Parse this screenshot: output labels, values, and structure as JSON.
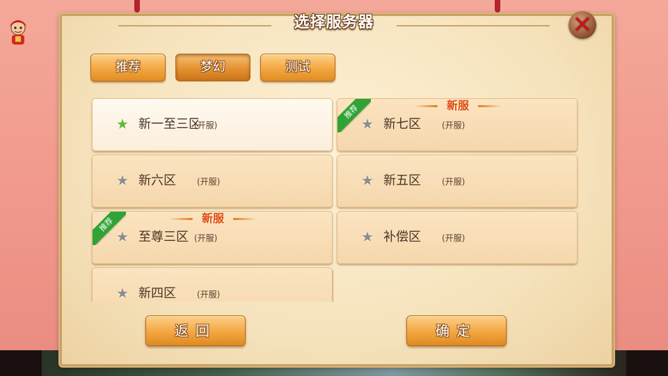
{
  "dialog": {
    "title": "选择服务器",
    "close_icon": "close-x-icon"
  },
  "tabs": [
    {
      "label": "推荐",
      "active": false
    },
    {
      "label": "梦幻",
      "active": true
    },
    {
      "label": "测试",
      "active": false
    }
  ],
  "servers": [
    {
      "name": "新一至三区",
      "status": "(开服)",
      "selected": true,
      "recommended": false,
      "new_label": ""
    },
    {
      "name": "新七区",
      "status": "(开服)",
      "selected": false,
      "recommended": true,
      "new_label": "新服"
    },
    {
      "name": "新六区",
      "status": "(开服)",
      "selected": false,
      "recommended": false,
      "new_label": ""
    },
    {
      "name": "新五区",
      "status": "(开服)",
      "selected": false,
      "recommended": false,
      "new_label": ""
    },
    {
      "name": "至尊三区",
      "status": "(开服)",
      "selected": false,
      "recommended": true,
      "new_label": "新服"
    },
    {
      "name": "补偿区",
      "status": "(开服)",
      "selected": false,
      "recommended": false,
      "new_label": ""
    },
    {
      "name": "新四区",
      "status": "(开服)",
      "selected": false,
      "recommended": false,
      "new_label": ""
    }
  ],
  "ribbon_label": "推荐",
  "buttons": {
    "back": "返回",
    "confirm": "确定"
  },
  "colors": {
    "selected_star": "#5fb83a",
    "star": "#8c8c8c",
    "ribbon": "#2fa334",
    "new_label": "#e04a10",
    "button": "#f3a640"
  }
}
